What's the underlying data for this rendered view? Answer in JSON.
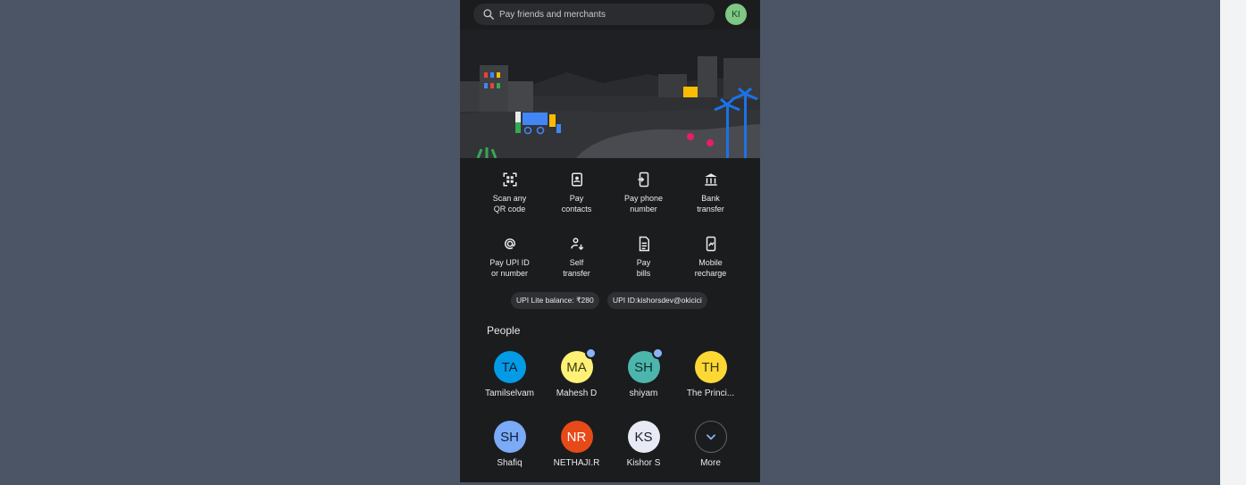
{
  "search": {
    "placeholder": "Pay friends and merchants"
  },
  "profile": {
    "initials": "KI"
  },
  "actions": [
    {
      "label_line1": "Scan any",
      "label_line2": "QR code",
      "icon": "qr-scan-icon"
    },
    {
      "label_line1": "Pay",
      "label_line2": "contacts",
      "icon": "contacts-icon"
    },
    {
      "label_line1": "Pay phone",
      "label_line2": "number",
      "icon": "phone-icon"
    },
    {
      "label_line1": "Bank",
      "label_line2": "transfer",
      "icon": "bank-icon"
    },
    {
      "label_line1": "Pay UPI ID",
      "label_line2": "or number",
      "icon": "at-icon"
    },
    {
      "label_line1": "Self",
      "label_line2": "transfer",
      "icon": "self-transfer-icon"
    },
    {
      "label_line1": "Pay",
      "label_line2": "bills",
      "icon": "bill-icon"
    },
    {
      "label_line1": "Mobile",
      "label_line2": "recharge",
      "icon": "mobile-recharge-icon"
    }
  ],
  "chips": {
    "lite_balance": "UPI Lite balance: ₹280",
    "upi_id": "UPI ID:kishorsdev@okicici"
  },
  "people": {
    "title": "People",
    "items": [
      {
        "initials": "TA",
        "name": "Tamilselvam",
        "color": "#039be5",
        "text_color": "#10233a",
        "dot": false
      },
      {
        "initials": "MA",
        "name": "Mahesh D",
        "color": "#fff176",
        "text_color": "#3a3a10",
        "dot": true
      },
      {
        "initials": "SH",
        "name": "shiyam",
        "color": "#4db6ac",
        "text_color": "#0f2e2b",
        "dot": true
      },
      {
        "initials": "TH",
        "name": "The Princi...",
        "color": "#fdd835",
        "text_color": "#3a3510",
        "dot": false
      },
      {
        "initials": "SH",
        "name": "Shafiq",
        "color": "#7baaf7",
        "text_color": "#10203a",
        "dot": false
      },
      {
        "initials": "NR",
        "name": "NETHAJI.R",
        "color": "#e64a19",
        "text_color": "#ffffff",
        "dot": false
      },
      {
        "initials": "KS",
        "name": "Kishor S",
        "color": "#e8eaf6",
        "text_color": "#202124",
        "dot": false
      },
      {
        "initials": "",
        "name": "More",
        "color": "#1b1c1e",
        "text_color": "#8ab4f8",
        "dot": false
      }
    ]
  }
}
